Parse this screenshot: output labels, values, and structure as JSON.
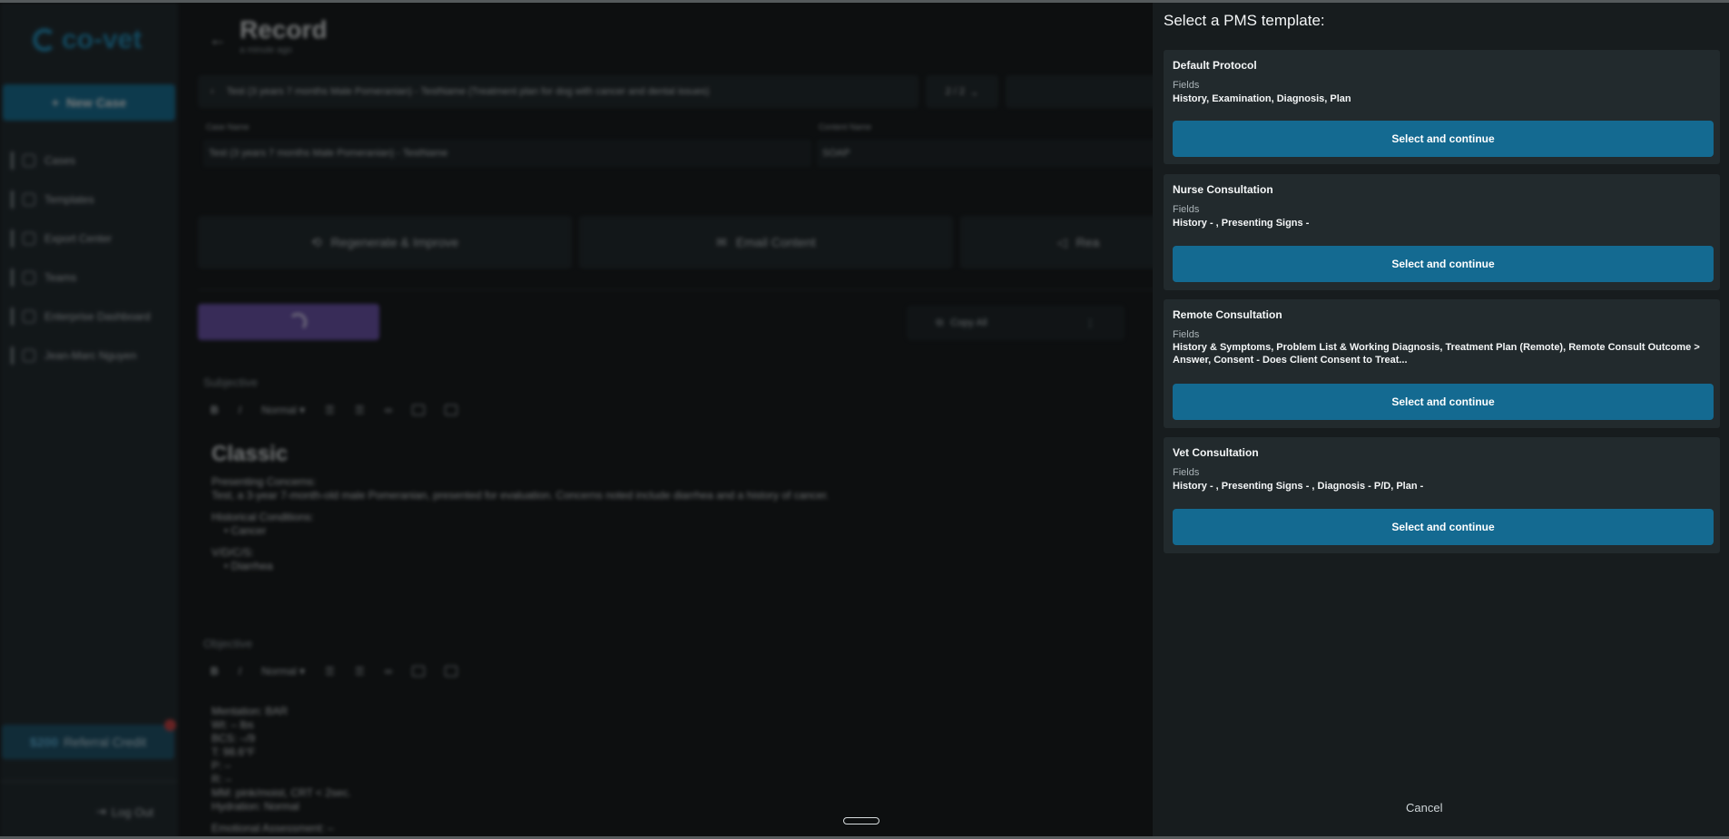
{
  "background": {
    "logo_text": "co-vet",
    "new_case_label": "New Case",
    "nav": [
      {
        "label": "Cases",
        "icon": "paw-icon"
      },
      {
        "label": "Templates",
        "icon": "template-icon"
      },
      {
        "label": "Export Center",
        "icon": "export-icon"
      },
      {
        "label": "Teams",
        "icon": "team-icon"
      },
      {
        "label": "Enterprise Dashboard",
        "icon": "dashboard-icon"
      },
      {
        "label": "Jean-Marc Nguyen",
        "icon": "avatar-icon"
      }
    ],
    "referral_amount": "$200",
    "referral_label": "Referral Credit",
    "logout_label": "Log Out",
    "record_title": "Record",
    "record_subtitle": "a minute ago",
    "case_selector": "Test (3 years 7 months Male Pomeranian) - TestName (Treatment plan for dog with cancer and dental issues)",
    "pager": "2 / 2",
    "case_name_label": "Case Name",
    "case_name_value": "Test (3 years 7 months Male Pomeranian) - TestName",
    "content_name_label": "Content Name",
    "content_name_value": "SOAP",
    "actions": [
      "Regenerate & Improve",
      "Email Content",
      "Rea"
    ],
    "copy_all_label": "Copy All",
    "subjective": {
      "section_label": "Subjective",
      "format": "Normal",
      "heading": "Classic",
      "presenting_label": "Presenting Concerns:",
      "presenting_text": "Test, a 3-year 7-month-old male Pomeranian, presented for evaluation. Concerns noted include diarrhea and a history of cancer.",
      "historical_label": "Historical Conditions:",
      "historical_item": "Cancer",
      "vdcs_label": "V/D/C/S:",
      "vdcs_item": "Diarrhea"
    },
    "objective": {
      "section_label": "Objective",
      "format": "Normal",
      "lines": [
        "Mentation: BAR",
        "Wt: – lbs",
        "BCS: –/9",
        "T: 98.6°F",
        "P: –",
        "R: –",
        "MM: pink/moist, CRT < 2sec.",
        "Hydration: Normal"
      ],
      "emotional": "Emotional Assessment: –"
    }
  },
  "modal": {
    "title": "Select a PMS template:",
    "fields_label": "Fields",
    "templates": [
      {
        "name": "Default Protocol",
        "fields": "History, Examination, Diagnosis, Plan",
        "button": "Select and continue"
      },
      {
        "name": "Nurse Consultation",
        "fields": "History - , Presenting Signs -",
        "button": "Select and continue"
      },
      {
        "name": "Remote Consultation",
        "fields": "History & Symptoms, Problem List & Working Diagnosis, Treatment Plan (Remote), Remote Consult Outcome > Answer, Consent - Does Client Consent to Treat...",
        "button": "Select and continue"
      },
      {
        "name": "Vet Consultation",
        "fields": "History - , Presenting Signs - , Diagnosis - P/D, Plan -",
        "button": "Select and continue"
      }
    ],
    "cancel_label": "Cancel"
  }
}
